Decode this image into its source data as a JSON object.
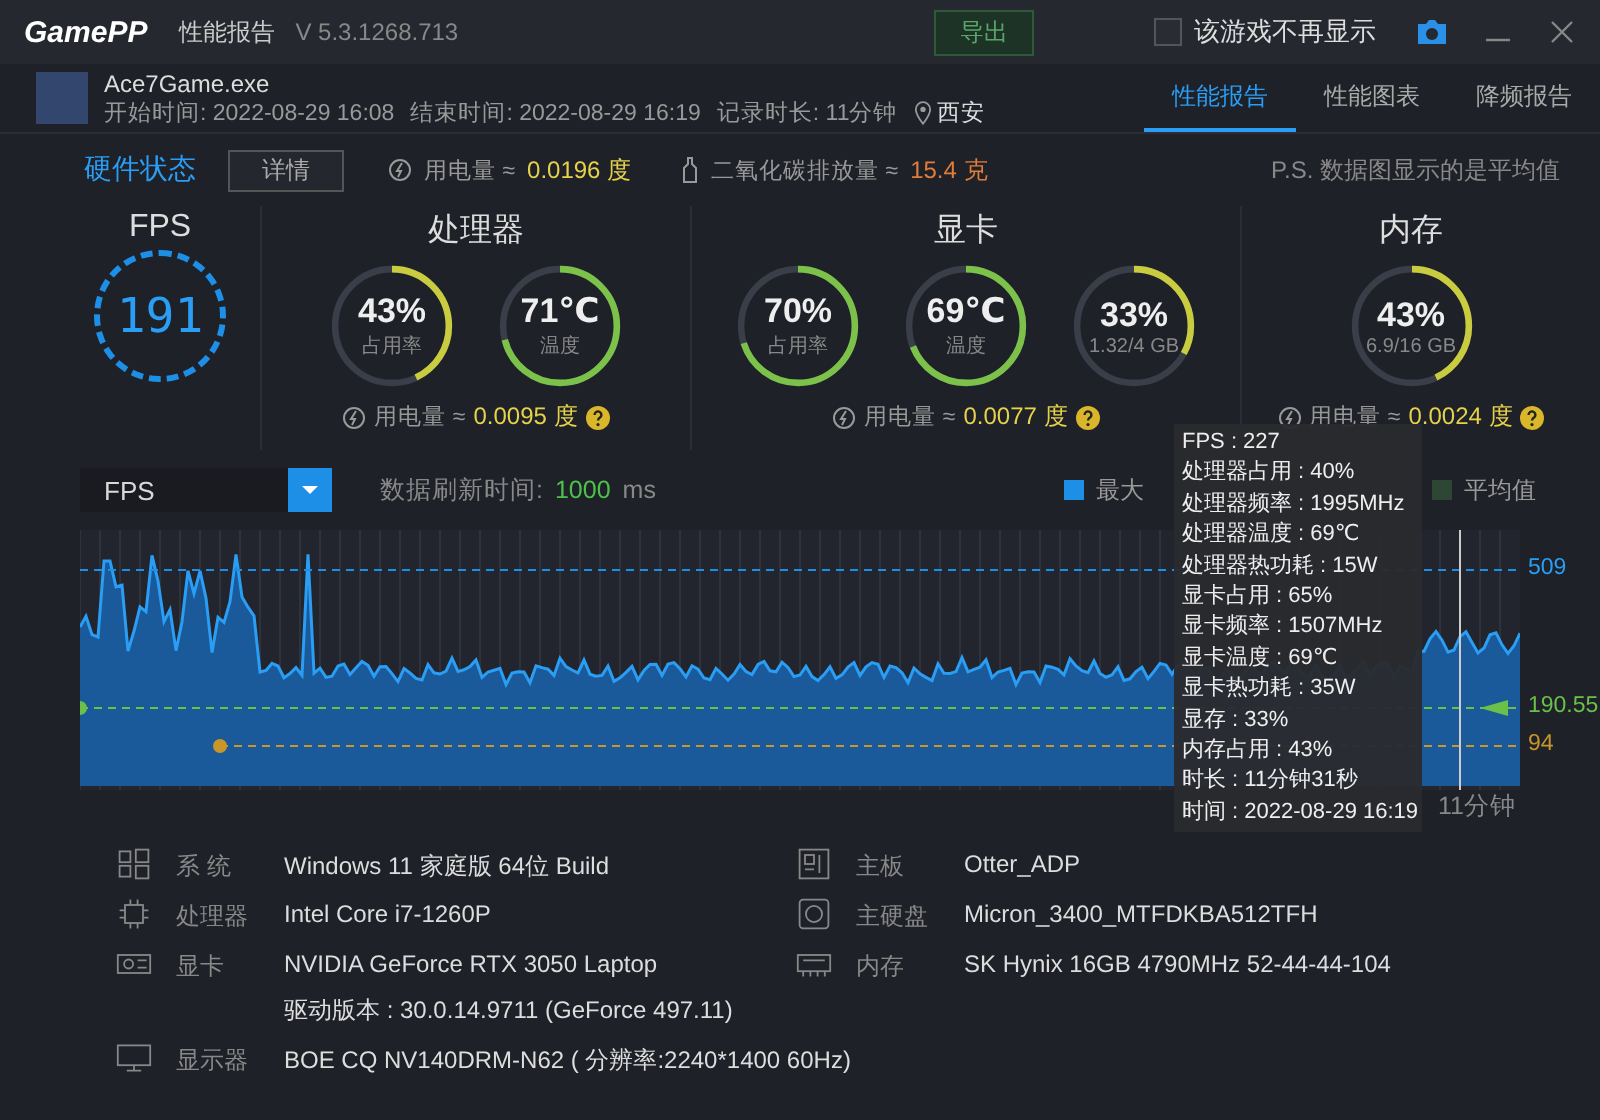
{
  "app": {
    "logo": "GamePP",
    "title": "性能报告",
    "version": "V 5.3.1268.713",
    "export_button": "导出",
    "dont_show": {
      "label": "该游戏不再显示",
      "checked": false
    }
  },
  "game": {
    "name": "Ace7Game.exe",
    "start": "开始时间: 2022-08-29 16:08",
    "end": "结束时间: 2022-08-29 16:19",
    "duration": "记录时长: 11分钟",
    "location": "西安"
  },
  "tabs": [
    {
      "label": "性能报告",
      "selected": true
    },
    {
      "label": "性能图表",
      "selected": false
    },
    {
      "label": "降频报告",
      "selected": false
    }
  ],
  "status": {
    "title": "硬件状态",
    "details_button": "详情",
    "power_label": "用电量 ≈",
    "power_value": "0.0196 度",
    "co2_label": "二氧化碳排放量 ≈",
    "co2_value": "15.4 克",
    "note": "P.S. 数据图显示的是平均值"
  },
  "fps": {
    "title": "FPS",
    "value": "191"
  },
  "groups": [
    {
      "title": "处理器",
      "gauges": [
        {
          "value": "43%",
          "label": "占用率",
          "level": 0.43
        },
        {
          "value": "71℃",
          "label": "温度",
          "level": 0.71
        }
      ],
      "power_label": "用电量 ≈",
      "power_value": "0.0095 度"
    },
    {
      "title": "显卡",
      "gauges": [
        {
          "value": "70%",
          "label": "占用率",
          "level": 0.7
        },
        {
          "value": "69℃",
          "label": "温度",
          "level": 0.69
        },
        {
          "value": "33%",
          "label": "1.32/4 GB",
          "level": 0.33
        }
      ],
      "power_label": "用电量 ≈",
      "power_value": "0.0077 度"
    },
    {
      "title": "内存",
      "gauges": [
        {
          "value": "43%",
          "label": "6.9/16 GB",
          "level": 0.43
        }
      ],
      "power_label": "用电量 ≈",
      "power_value": "0.0024 度"
    }
  ],
  "chart_controls": {
    "metric": "FPS",
    "refresh_label": "数据刷新时间:",
    "refresh_value": "1000",
    "refresh_unit": "ms",
    "legend": [
      {
        "label": "最大",
        "color": "#1e8fe6"
      },
      {
        "label": "平均值",
        "color": "#2e4634"
      }
    ]
  },
  "chart": {
    "max_label": "509",
    "avg_label": "190.55",
    "min_label": "94",
    "time_label": "11分钟"
  },
  "tooltip": [
    "FPS : 227",
    "处理器占用 : 40%",
    "处理器频率 : 1995MHz",
    "处理器温度 : 69℃",
    "处理器热功耗 : 15W",
    "显卡占用 : 65%",
    "显卡频率 : 1507MHz",
    "显卡温度 : 69℃",
    "显卡热功耗 : 35W",
    "显存 : 33%",
    "内存占用 : 43%",
    "时长 : 11分钟31秒",
    "时间 : 2022-08-29 16:19"
  ],
  "system_info": [
    {
      "kind": "os",
      "label": "系 统",
      "value": "Windows 11 家庭版 64位   Build"
    },
    {
      "kind": "board",
      "label": "主板",
      "value": "Otter_ADP"
    },
    {
      "kind": "cpu",
      "label": "处理器",
      "value": "Intel Core i7-1260P"
    },
    {
      "kind": "disk",
      "label": "主硬盘",
      "value": "Micron_3400_MTFDKBA512TFH"
    },
    {
      "kind": "gpu",
      "label": "显卡",
      "value": "NVIDIA GeForce RTX 3050 Laptop",
      "extra": "驱动版本 : 30.0.14.9711 (GeForce 497.11)"
    },
    {
      "kind": "memory",
      "label": "内存",
      "value": "SK Hynix 16GB 4790MHz 52-44-44-104"
    },
    {
      "kind": "monitor",
      "label": "显示器",
      "value": "BOE CQ NV140DRM-N62 ( 分辨率:2240*1400 60Hz)"
    }
  ]
}
